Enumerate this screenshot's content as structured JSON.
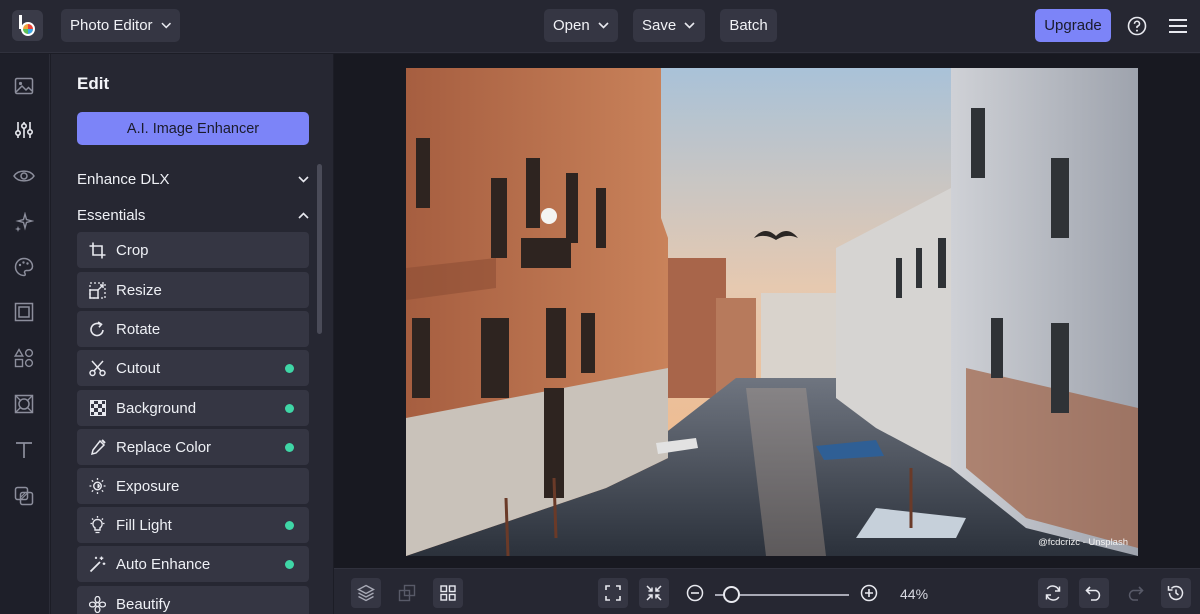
{
  "topbar": {
    "app_menu_label": "Photo Editor",
    "open_label": "Open",
    "save_label": "Save",
    "batch_label": "Batch",
    "upgrade_label": "Upgrade"
  },
  "rail": {
    "icons": [
      "image-icon",
      "sliders-icon",
      "eye-icon",
      "sparkle-icon",
      "palette-icon",
      "frame-icon",
      "shapes-icon",
      "texture-icon",
      "text-icon",
      "layers-overlap-icon"
    ]
  },
  "panel": {
    "title": "Edit",
    "ai_button": "A.I. Image Enhancer",
    "section_enhance": "Enhance DLX",
    "section_essentials": "Essentials",
    "tools": [
      {
        "label": "Crop",
        "icon": "crop-icon",
        "badge": false
      },
      {
        "label": "Resize",
        "icon": "resize-icon",
        "badge": false
      },
      {
        "label": "Rotate",
        "icon": "rotate-icon",
        "badge": false
      },
      {
        "label": "Cutout",
        "icon": "scissors-icon",
        "badge": true
      },
      {
        "label": "Background",
        "icon": "checkerboard-icon",
        "badge": true
      },
      {
        "label": "Replace Color",
        "icon": "eyedropper-icon",
        "badge": true
      },
      {
        "label": "Exposure",
        "icon": "sun-icon",
        "badge": false
      },
      {
        "label": "Fill Light",
        "icon": "bulb-icon",
        "badge": true
      },
      {
        "label": "Auto Enhance",
        "icon": "magic-wand-icon",
        "badge": true
      },
      {
        "label": "Beautify",
        "icon": "flower-icon",
        "badge": false
      }
    ]
  },
  "canvas": {
    "photo_credit": "@fcdcrizc - Unsplash"
  },
  "bottombar": {
    "zoom_value": "44%",
    "zoom_level": 0.44
  },
  "colors": {
    "accent": "#7c84f8",
    "badge": "#3fd6a6",
    "panel_bg": "#262732",
    "tool_bg": "#353643"
  }
}
